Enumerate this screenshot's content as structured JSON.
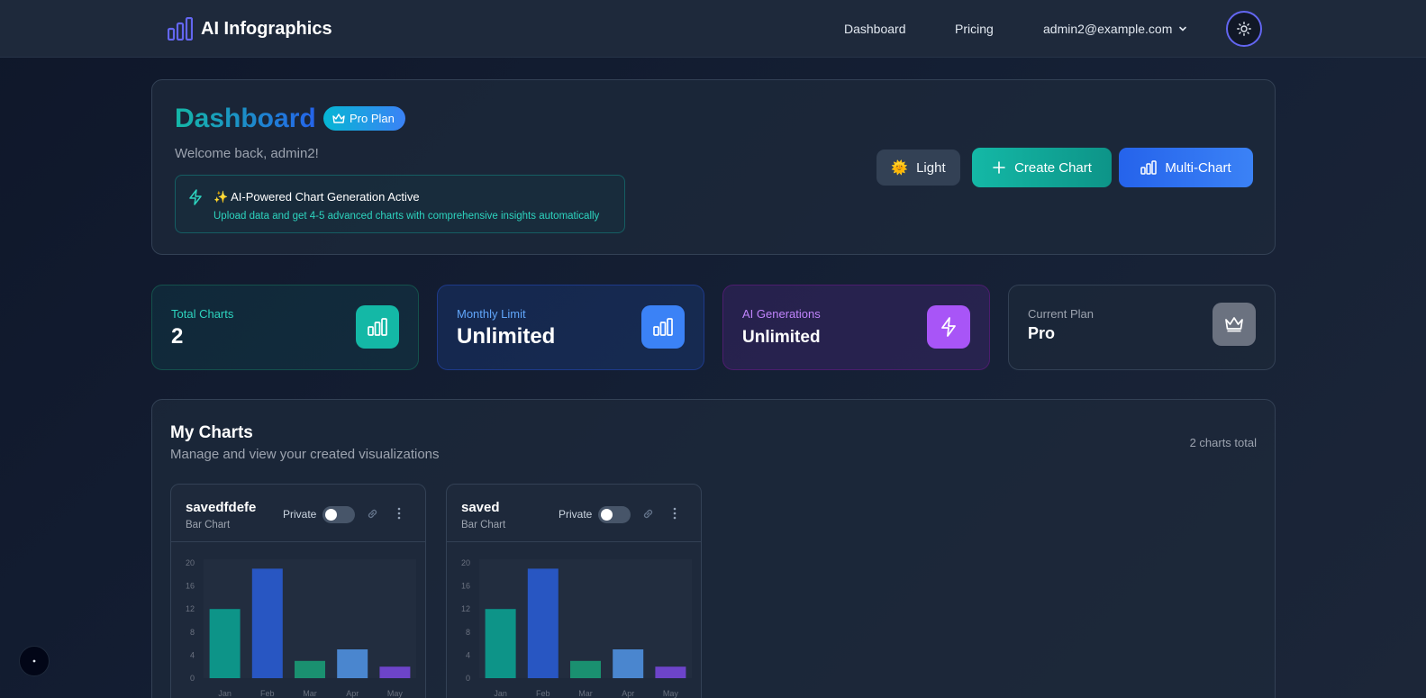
{
  "nav": {
    "brand": "AI Infographics",
    "links": [
      "Dashboard",
      "Pricing"
    ],
    "user_email": "admin2@example.com",
    "theme_icon": "sun-icon"
  },
  "header": {
    "title": "Dashboard",
    "plan_badge": "Pro Plan",
    "welcome": "Welcome back, admin2!",
    "ai_banner": {
      "title": "✨ AI-Powered Chart Generation Active",
      "subtitle": "Upload data and get 4-5 advanced charts with comprehensive insights automatically"
    },
    "buttons": {
      "light": "Light",
      "light_icon": "🌞",
      "create": "Create Chart",
      "multi": "Multi-Chart"
    }
  },
  "stats": [
    {
      "label": "Total Charts",
      "value": "2",
      "icon": "bar-chart-icon",
      "label_color": "#2dd4bf",
      "icon_bg": "#14b8a6"
    },
    {
      "label": "Monthly Limit",
      "value": "Unlimited",
      "icon": "bar-chart-icon",
      "label_color": "#60a5fa",
      "icon_bg": "#3b82f6"
    },
    {
      "label": "AI Generations",
      "value": "Unlimited",
      "icon": "lightning-icon",
      "label_color": "#c084fc",
      "icon_bg": "#a855f7"
    },
    {
      "label": "Current Plan",
      "value": "Pro",
      "icon": "crown-icon",
      "label_color": "#9ca3af",
      "icon_bg": "#6b7280"
    }
  ],
  "my_charts": {
    "title": "My Charts",
    "subtitle": "Manage and view your created visualizations",
    "count": "2 charts total",
    "items": [
      {
        "name": "savedfdefe",
        "type": "Bar Chart",
        "visibility": "Private"
      },
      {
        "name": "saved",
        "type": "Bar Chart",
        "visibility": "Private"
      }
    ]
  },
  "chart_data": [
    {
      "type": "bar",
      "categories": [
        "Jan",
        "Feb",
        "Mar",
        "Apr",
        "May"
      ],
      "values": [
        12,
        19,
        3,
        5,
        2
      ],
      "yticks": [
        "0",
        "4",
        "8",
        "12",
        "16",
        "20"
      ],
      "ylim": [
        0,
        20
      ],
      "colors": [
        "#0d9488",
        "#2856c2",
        "#1a9070",
        "#4a86cf",
        "#6d44c9"
      ]
    },
    {
      "type": "bar",
      "categories": [
        "Jan",
        "Feb",
        "Mar",
        "Apr",
        "May"
      ],
      "values": [
        12,
        19,
        3,
        5,
        2
      ],
      "yticks": [
        "0",
        "4",
        "8",
        "12",
        "16",
        "20"
      ],
      "ylim": [
        0,
        20
      ],
      "colors": [
        "#0d9488",
        "#2856c2",
        "#1a9070",
        "#4a86cf",
        "#6d44c9"
      ]
    }
  ]
}
